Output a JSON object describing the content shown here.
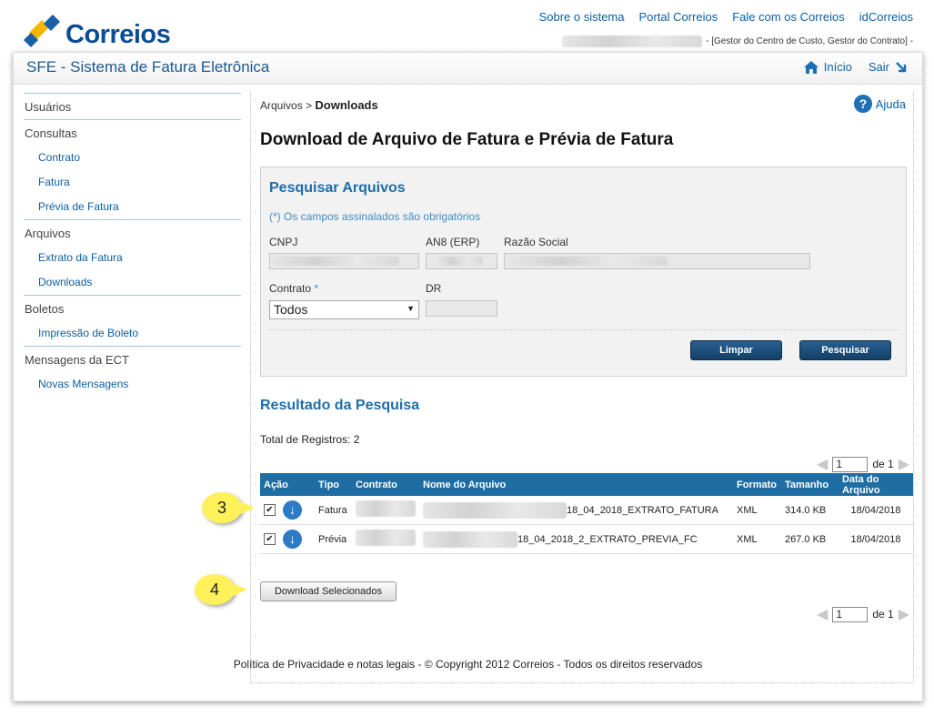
{
  "top_links": [
    "Sobre o sistema",
    "Portal Correios",
    "Fale com os Correios",
    "idCorreios"
  ],
  "logo_text": "Correios",
  "user_roles": "- [Gestor do Centro de Custo, Gestor do Contrato] -",
  "header": {
    "system_title": "SFE - Sistema de Fatura Eletrônica",
    "home_label": "Início",
    "logout_label": "Sair"
  },
  "sidebar": {
    "groups": [
      {
        "label": "Usuários",
        "items": []
      },
      {
        "label": "Consultas",
        "items": [
          "Contrato",
          "Fatura",
          "Prévia de Fatura"
        ]
      },
      {
        "label": "Arquivos",
        "items": [
          "Extrato da Fatura",
          "Downloads"
        ]
      },
      {
        "label": "Boletos",
        "items": [
          "Impressão de Boleto"
        ]
      },
      {
        "label": "Mensagens da ECT",
        "items": [
          "Novas Mensagens"
        ]
      }
    ]
  },
  "breadcrumb": {
    "parent": "Arquivos",
    "separator": ">",
    "current": "Downloads"
  },
  "help_label": "Ajuda",
  "page_title": "Download de Arquivo de Fatura e Prévia de Fatura",
  "search": {
    "title": "Pesquisar Arquivos",
    "required_note": "(*) Os campos assinalados são obrigatórios",
    "cnpj_label": "CNPJ",
    "an8_label": "AN8 (ERP)",
    "razao_label": "Razão Social",
    "contrato_label": "Contrato",
    "contrato_required": "*",
    "contrato_value": "Todos",
    "dr_label": "DR",
    "clear_button": "Limpar",
    "search_button": "Pesquisar"
  },
  "results": {
    "title": "Resultado da Pesquisa",
    "total_label": "Total de Registros: 2",
    "pager": {
      "page": "1",
      "of_label": "de 1"
    },
    "columns": [
      "Ação",
      "Tipo",
      "Contrato",
      "Nome do Arquivo",
      "Formato",
      "Tamanho",
      "Data do Arquivo"
    ],
    "rows": [
      {
        "checked": true,
        "tipo": "Fatura",
        "file_suffix": "18_04_2018_EXTRATO_FATURA",
        "formato": "XML",
        "tamanho": "314.0 KB",
        "data": "18/04/2018"
      },
      {
        "checked": true,
        "tipo": "Prévia",
        "file_suffix": "18_04_2018_2_EXTRATO_PREVIA_FC",
        "formato": "XML",
        "tamanho": "267.0 KB",
        "data": "18/04/2018"
      }
    ],
    "download_button": "Download Selecionados"
  },
  "callouts": [
    "3",
    "4"
  ],
  "footer": "Política de Privacidade e notas legais - © Copyright 2012 Correios - Todos os direitos reservados",
  "colors": {
    "brand_blue": "#0a4d94",
    "table_header": "#1e6da3",
    "callout_yellow": "#fff159",
    "logo_yellow": "#f7b500"
  }
}
